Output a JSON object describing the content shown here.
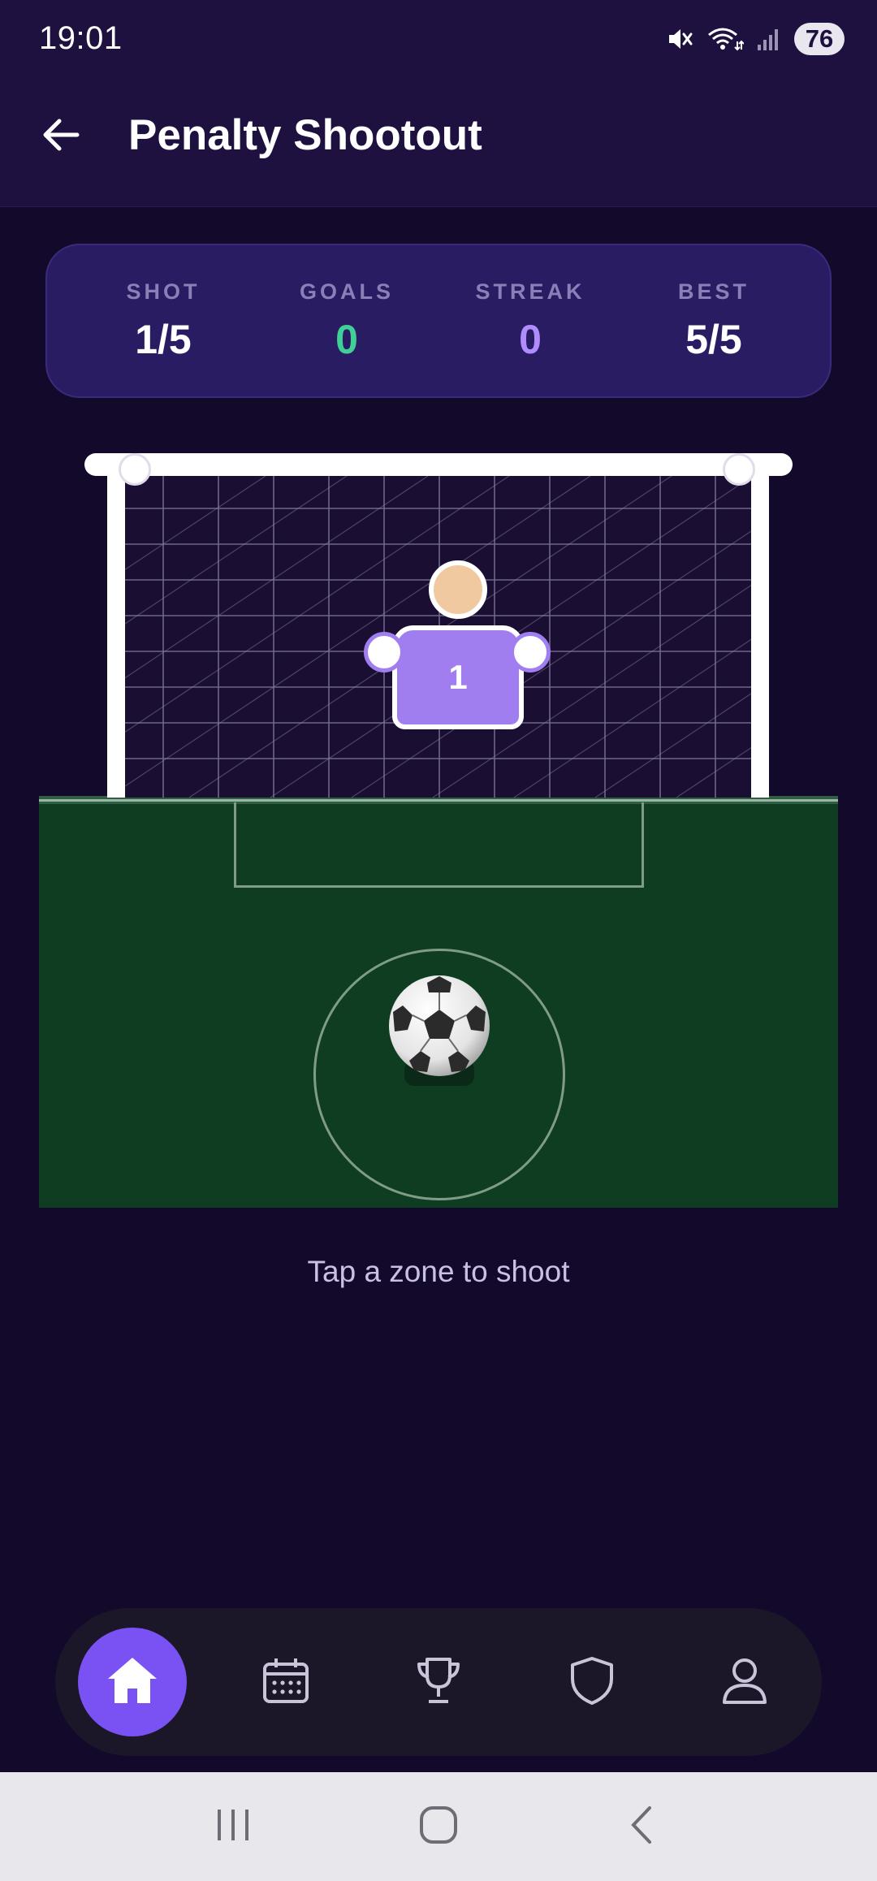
{
  "status_bar": {
    "time": "19:01",
    "battery": "76",
    "icons": [
      "mute-icon",
      "wifi-icon",
      "signal-icon"
    ]
  },
  "header": {
    "title": "Penalty Shootout",
    "back_icon": "arrow-left-icon"
  },
  "stats": {
    "shot": {
      "label": "SHOT",
      "value": "1/5",
      "color": "#ffffff"
    },
    "goals": {
      "label": "GOALS",
      "value": "0",
      "color": "#3fcf97"
    },
    "streak": {
      "label": "STREAK",
      "value": "0",
      "color": "#b08cff"
    },
    "best": {
      "label": "BEST",
      "value": "5/5",
      "color": "#ffffff"
    }
  },
  "goal": {
    "keeper_number": "1",
    "ball": "⚽"
  },
  "hint": "Tap a zone to shoot",
  "bottom_nav": {
    "items": [
      {
        "name": "home",
        "icon": "home-icon",
        "active": true
      },
      {
        "name": "calendar",
        "icon": "calendar-icon",
        "active": false
      },
      {
        "name": "trophy",
        "icon": "trophy-icon",
        "active": false
      },
      {
        "name": "shield",
        "icon": "shield-icon",
        "active": false
      },
      {
        "name": "profile",
        "icon": "user-icon",
        "active": false
      }
    ]
  },
  "colors": {
    "background": "#130a2b",
    "header": "#1e1140",
    "card": "#2a1c63",
    "accent": "#7a52f4",
    "pitch": "#0f3d21",
    "keeper": "#a07ef0"
  }
}
